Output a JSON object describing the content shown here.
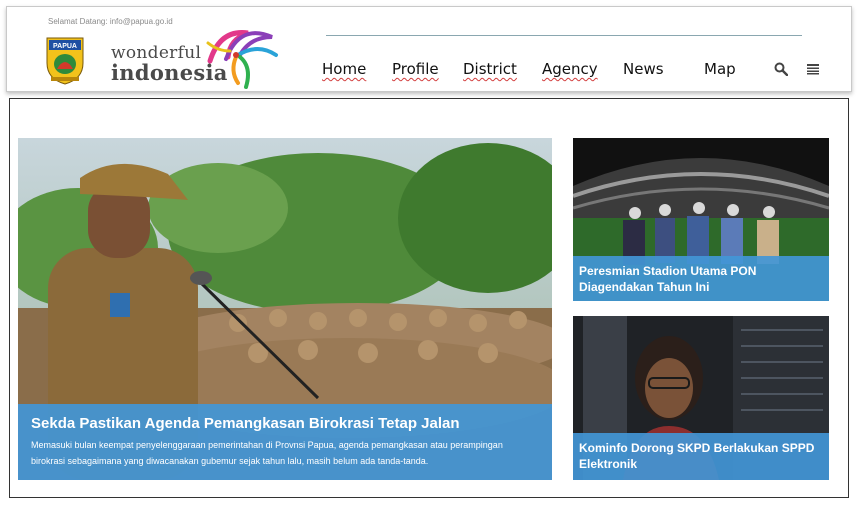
{
  "header": {
    "welcome_text": "Selamat Datang: info@papua.go.id",
    "crest_label": "PAPUA",
    "logo_line1": "wonderful",
    "logo_line2": "indonesia"
  },
  "nav": {
    "items": [
      {
        "label": "Home"
      },
      {
        "label": "Profile"
      },
      {
        "label": "District"
      },
      {
        "label": "Agency"
      },
      {
        "label": "News"
      },
      {
        "label": "Map"
      }
    ],
    "search_icon": "search-icon",
    "menu_icon": "menu-icon"
  },
  "featured": {
    "title": "Sekda Pastikan Agenda Pemangkasan Birokrasi Tetap Jalan",
    "description": "Memasuki bulan keempat penyelenggaraan pemerintahan di Provnsi Papua, agenda pemangkasan atau perampingan birokrasi sebagaimana yang diwacanakan gubemur sejak tahun lalu, masih belum ada tanda-tanda."
  },
  "side_news": [
    {
      "title": "Peresmian Stadion Utama PON Diagendakan Tahun Ini"
    },
    {
      "title": "Kominfo Dorong SKPD Berlakukan SPPD Elektronik"
    }
  ],
  "colors": {
    "caption_bg": "#4296d6",
    "nav_text": "#111111",
    "welcome_text": "#8a8a8a"
  }
}
